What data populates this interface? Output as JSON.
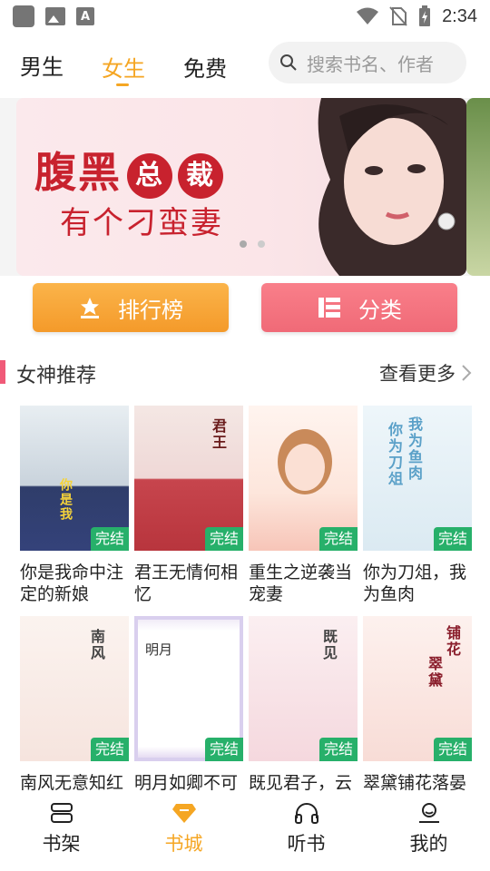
{
  "status_bar": {
    "time": "2:34"
  },
  "top_nav": {
    "tabs": [
      {
        "label": "男生",
        "active": false
      },
      {
        "label": "女生",
        "active": true
      },
      {
        "label": "免费",
        "active": false
      }
    ],
    "search_placeholder": "搜索书名、作者"
  },
  "banner": {
    "line1_a": "腹黑",
    "line1_b1": "总",
    "line1_b2": "裁",
    "line2": "有个刁蛮妻"
  },
  "category_buttons": {
    "rank": "排行榜",
    "category": "分类"
  },
  "section": {
    "title": "女神推荐",
    "more": "查看更多"
  },
  "books": [
    {
      "title": "你是我命中注定的新娘",
      "badge": "完结"
    },
    {
      "title": "君王无情何相忆",
      "badge": "完结"
    },
    {
      "title": "重生之逆袭当宠妻",
      "badge": "完结"
    },
    {
      "title": "你为刀俎，我为鱼肉",
      "badge": "完结"
    },
    {
      "title": "南风无意知红豆",
      "badge": "完结"
    },
    {
      "title": "明月如卿不可绝",
      "badge": "完结"
    },
    {
      "title": "既见君子，云胡不乐",
      "badge": "完结"
    },
    {
      "title": "翠黛铺花落晏",
      "badge": "完结"
    }
  ],
  "bottom_nav": [
    {
      "label": "书架",
      "active": false
    },
    {
      "label": "书城",
      "active": true
    },
    {
      "label": "听书",
      "active": false
    },
    {
      "label": "我的",
      "active": false
    }
  ],
  "colors": {
    "accent": "#f5a623",
    "pink": "#f06a77",
    "badge": "#27b06a",
    "banner_red": "#c8222e"
  }
}
